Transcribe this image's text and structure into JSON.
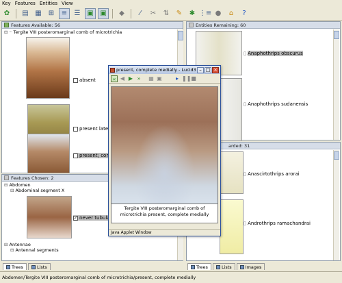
{
  "menu": [
    "Key",
    "Features",
    "Entities",
    "View"
  ],
  "toolbar": [
    "open-key-icon",
    "features-icon",
    "entities-icon",
    "tree-icon",
    "list-icon",
    "image-icon",
    "image-alt-icon",
    "tag-icon",
    "wand-icon",
    "scissors-icon",
    "sort-icon",
    "target-icon",
    "filter-icon",
    "subset-icon",
    "tag-alt-icon",
    "home-icon",
    "help-icon"
  ],
  "features_available": {
    "title": "Features Available: 56",
    "root": "Tergite VIII posteromarginal comb of microtrichia",
    "states": [
      "absent",
      "present laterally",
      "present; compl"
    ]
  },
  "features_chosen": {
    "title": "Features Chosen: 2",
    "items": [
      "Abdomen",
      "Abdominal segment X",
      "never tubular; la",
      "Antennae",
      "Antennal segments"
    ]
  },
  "entities_remaining": {
    "title": "Entities Remaining: 60",
    "items": [
      "Anaphothrips obscurus",
      "Anaphothrips sudanensis"
    ]
  },
  "entities_discarded": {
    "title": "arded: 31",
    "items": [
      "Anascirtothrips arorai",
      "Androthrips ramachandrai"
    ]
  },
  "left_tabs": [
    "Trees",
    "Lists"
  ],
  "right_tabs": [
    "Trees",
    "Lists",
    "Images"
  ],
  "status": "Abdomen/Tergite VIII posteromarginal comb of microtrichia/present, complete medially",
  "popup": {
    "title": "present, complete medially - Lucid3",
    "caption": "Tergite VIII posteromarginal comb of microtrichia present, complete medially",
    "footer": "Java Applet Window"
  }
}
